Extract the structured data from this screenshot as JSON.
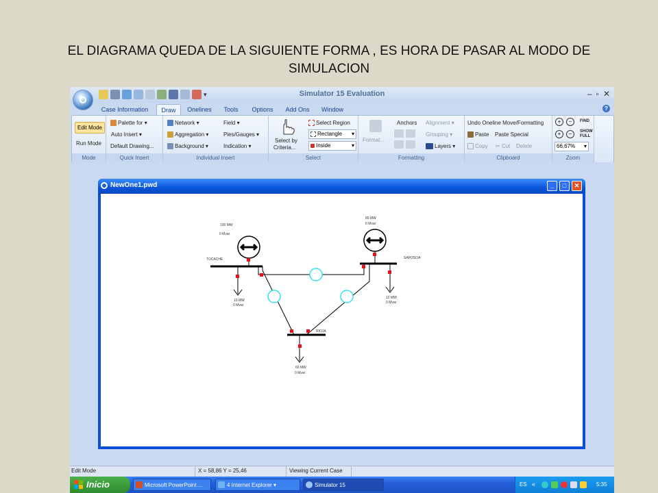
{
  "slide": {
    "caption": "EL DIAGRAMA QUEDA DE LA SIGUIENTE FORMA , ES HORA DE PASAR AL MODO DE SIMULACION"
  },
  "app": {
    "title": "Simulator 15 Evaluation",
    "window_controls": [
      "–",
      "▫",
      "✕"
    ],
    "tabs": [
      "Case Information",
      "Draw",
      "Onelines",
      "Tools",
      "Options",
      "Add Ons",
      "Window"
    ],
    "active_tab": "Draw"
  },
  "ribbon": {
    "mode": {
      "label": "Mode",
      "edit_mode": "Edit Mode",
      "run_mode": "Run Mode"
    },
    "quick_insert": {
      "label": "Quick Insert",
      "palette": "Palette for",
      "auto_insert": "Auto Insert",
      "default_drawing": "Default Drawing..."
    },
    "individual_insert": {
      "label": "Individual Insert",
      "network": "Network",
      "aggregation": "Aggregation",
      "background": "Background",
      "field": "Field",
      "pies_gauges": "Pies/Gauges",
      "indication": "Indication"
    },
    "select": {
      "label": "Select",
      "select_by_criteria_1": "Select by",
      "select_by_criteria_2": "Criteria...",
      "select_region": "Select Region",
      "rectangle": "Rectangle",
      "inside": "Inside"
    },
    "formatting": {
      "label": "Formatting",
      "format": "Format...",
      "anchors": "Anchors",
      "alignment": "Alignment",
      "grouping": "Grouping",
      "layers": "Layers"
    },
    "clipboard": {
      "label": "Clipboard",
      "undo": "Undo Oneline Move/Formatting",
      "paste": "Paste",
      "paste_special": "Paste Special",
      "copy": "Copy",
      "cut": "Cut",
      "delete": "Delete"
    },
    "zoom": {
      "label": "Zoom",
      "level": "66,67%",
      "find": "FIND",
      "show_full": "SHOW FULL"
    }
  },
  "child_window": {
    "title": "NewOne1.pwd",
    "buttons": [
      "_",
      "□",
      "✕"
    ]
  },
  "oneline": {
    "gen_left": {
      "mw": "100 MW",
      "mvar": "0 Mvar"
    },
    "gen_right": {
      "mw": "80 MW",
      "mvar": "0 Mvar"
    },
    "bus_left": "TOCACHE",
    "bus_right": "SAPOSOA",
    "bus_bottom": "RIOJA",
    "load_left": {
      "mw": "10 MW",
      "mvar": "0 Mvar"
    },
    "load_right": {
      "mw": "12 MW",
      "mvar": "0 Mvar"
    },
    "load_bottom": {
      "mw": "60 MW",
      "mvar": "0 Mvar"
    }
  },
  "statusbar": {
    "mode": "Edit Mode",
    "coords": "X = 58,86 Y = 25,46",
    "case_status": "Viewing Current Case"
  },
  "taskbar": {
    "start": "Inicio",
    "items": [
      "Microsoft PowerPoint ...",
      "4 Internet Explorer",
      "Simulator 15"
    ],
    "lang": "ES",
    "clock": "5:35"
  },
  "colors": {
    "breaker": "#e8101a",
    "flow_gauge": "#35e0ee",
    "child_title": "#0a55d9",
    "taskbar": "#245edb"
  }
}
